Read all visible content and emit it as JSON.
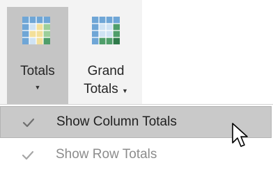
{
  "ribbon": {
    "totals_button": {
      "label": "Totals",
      "icon": "totals-grid-icon",
      "caret": "▼",
      "state": "pressed"
    },
    "grand_totals_button": {
      "label_line1": "Grand",
      "label_line2": "Totals",
      "icon": "grand-totals-grid-icon",
      "caret": "▼"
    }
  },
  "menu": {
    "items": [
      {
        "label": "Show Column Totals",
        "checked": true,
        "state": "hovered",
        "icon": "check-icon"
      },
      {
        "label": "Show Row Totals",
        "checked": true,
        "state": "disabled",
        "icon": "check-icon"
      }
    ]
  },
  "colors": {
    "ribbon_bg": "#f3f3f3",
    "pressed_bg": "#c5c5c5",
    "hover_bg": "#c9c9c9",
    "grid_blue": "#6fa6d6",
    "grid_yellow": "#f3e09a",
    "grid_green": "#9ccf9a",
    "grid_dark_green": "#4f9e6a"
  },
  "cursor": {
    "icon": "arrow-cursor-icon"
  }
}
